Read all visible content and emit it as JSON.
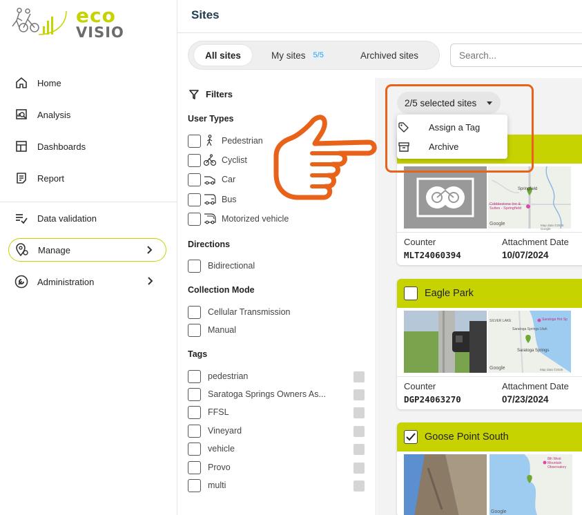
{
  "brand": {
    "name_top": "eco",
    "name_bottom": "VISIO",
    "accent_color": "#c7d300",
    "highlight_color": "#e8621a"
  },
  "sidebar": {
    "items": [
      {
        "label": "Home",
        "icon": "home-icon"
      },
      {
        "label": "Analysis",
        "icon": "analysis-icon"
      },
      {
        "label": "Dashboards",
        "icon": "dashboard-icon"
      },
      {
        "label": "Report",
        "icon": "report-icon"
      },
      {
        "label": "Data validation",
        "icon": "data-validation-icon"
      },
      {
        "label": "Manage",
        "icon": "manage-icon",
        "active": true
      },
      {
        "label": "Administration",
        "icon": "wrench-icon"
      }
    ]
  },
  "header": {
    "title": "Sites"
  },
  "tabs": {
    "all": "All sites",
    "my": "My sites",
    "my_count": "5/5",
    "archived": "Archived sites"
  },
  "search": {
    "placeholder": "Search..."
  },
  "filters": {
    "title": "Filters",
    "user_types_title": "User Types",
    "user_types": [
      "Pedestrian",
      "Cyclist",
      "Car",
      "Bus",
      "Motorized vehicle"
    ],
    "directions_title": "Directions",
    "directions": [
      "Bidirectional"
    ],
    "collection_title": "Collection Mode",
    "collection": [
      "Cellular Transmission",
      "Manual"
    ],
    "tags_title": "Tags",
    "tags": [
      "pedestrian",
      "Saratoga Springs Owners As...",
      "FFSL",
      "Vineyard",
      "vehicle",
      "Provo",
      "multi"
    ]
  },
  "selection": {
    "button": "2/5 selected sites",
    "menu": [
      {
        "label": "Assign a Tag",
        "icon": "tag-icon"
      },
      {
        "label": "Archive",
        "icon": "archive-icon"
      }
    ]
  },
  "cards": [
    {
      "name": "",
      "counter_label": "Counter",
      "counter": "MLT24060394",
      "date_label": "Attachment Date",
      "date": "10/07/2024",
      "map_labels": [
        "Springfield",
        "Cobblestone Inn & Suites - Springfield",
        "Google",
        "Map data ©2025 Google"
      ]
    },
    {
      "name": "Eagle Park",
      "checked": false,
      "counter_label": "Counter",
      "counter": "DGP24063270",
      "date_label": "Attachment Date",
      "date": "07/23/2024",
      "map_labels": [
        "SILVER LAKE",
        "Saratoga Hot Sp",
        "Saratoga Springs Utah",
        "Saratoga Springs",
        "Google",
        "Map data ©2025"
      ]
    },
    {
      "name": "Goose Point South",
      "checked": true,
      "map_labels": [
        "8th West Mountain Observatory",
        "Google"
      ]
    }
  ]
}
